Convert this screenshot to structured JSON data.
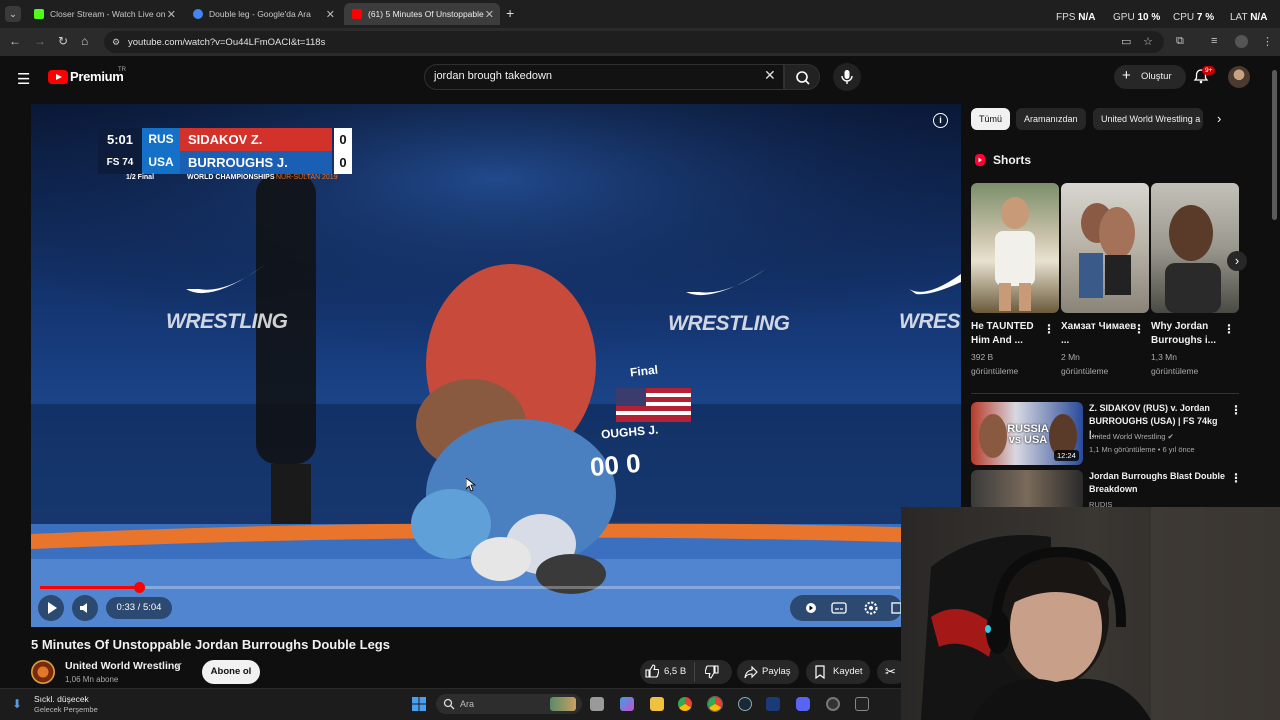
{
  "browser": {
    "tabs": [
      {
        "title": "Closer Stream - Watch Live on",
        "favicon_color": "#53fc18",
        "active": false
      },
      {
        "title": "Double leg - Google'da Ara",
        "favicon_color": "#4285f4",
        "active": false
      },
      {
        "title": "(61) 5 Minutes Of Unstoppable",
        "favicon_color": "#ff0000",
        "active": true
      }
    ],
    "new_tab": "+",
    "url": "youtube.com/watch?v=Ou44LFmOACI&t=118s"
  },
  "hud": {
    "fps_label": "FPS",
    "fps_value": "N/A",
    "gpu_label": "GPU",
    "gpu_value": "10 %",
    "cpu_label": "CPU",
    "cpu_value": "7 %",
    "lat_label": "LAT",
    "lat_value": "N/A"
  },
  "youtube": {
    "logo_text": "Premium",
    "region": "TR",
    "search_value": "jordan brough takedown",
    "create_label": "Oluştur",
    "notif_badge": "9+"
  },
  "player": {
    "scoreboard": {
      "time": "5:01",
      "weight": "FS 74",
      "rows": [
        {
          "country": "RUS",
          "name": "SIDAKOV Z.",
          "score": "0",
          "color": "#d3322b"
        },
        {
          "country": "USA",
          "name": "BURROUGHS J.",
          "score": "0",
          "color": "#1a5fb4"
        }
      ],
      "round": "1/2 Final",
      "event": "WORLD CHAMPIONSHIPS",
      "event_loc": "NUR-SULTAN 2019"
    },
    "watermark": "WRESTLING",
    "bg_round": "Final",
    "bg_name": "OUGHS J.",
    "bg_score": "00  0",
    "current_time": "0:33",
    "duration": "5:04",
    "time_display": "0:33 / 5:04",
    "progress_fraction": 0.115
  },
  "video": {
    "title": "5 Minutes Of Unstoppable Jordan Burroughs Double Legs",
    "channel": "United World Wrestling",
    "subscribers": "1,06 Mn abone",
    "subscribe_label": "Abone ol",
    "likes": "6,5 B",
    "share_label": "Paylaş",
    "save_label": "Kaydet"
  },
  "sidebar": {
    "chips": [
      "Tümü",
      "Aramanızdan",
      "United World Wrestling a"
    ],
    "shorts_heading": "Shorts",
    "shorts": [
      {
        "title": "He TAUNTED Him And ...",
        "views": "392 B",
        "views_unit": "görüntüleme"
      },
      {
        "title": "Хамзат Чимаев ...",
        "views": "2 Mn",
        "views_unit": "görüntüleme"
      },
      {
        "title": "Why Jordan Burroughs i...",
        "views": "1,3 Mn",
        "views_unit": "görüntüleme"
      }
    ],
    "videos": [
      {
        "title": "Z. SIDAKOV (RUS) v. Jordan BURROUGHS (USA) | FS 74kg |...",
        "channel": "United World Wrestling",
        "meta": "1,1 Mn görüntüleme • 6 yıl önce",
        "duration": "12:24",
        "thumb_text": "RUSSIA vs USA"
      },
      {
        "title": "Jordan Burroughs Blast Double Breakdown",
        "channel": "RUDIS",
        "meta": "",
        "duration": "",
        "thumb_text": ""
      }
    ]
  },
  "taskbar": {
    "weather_title": "Sıckl. düşecek",
    "weather_sub": "Gelecek Perşembe",
    "search_label": "Ara"
  }
}
